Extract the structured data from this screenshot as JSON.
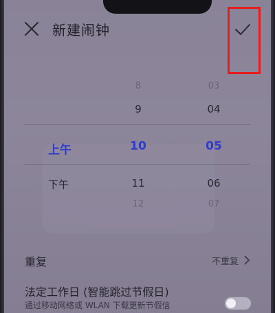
{
  "header": {
    "title": "新建闹钟",
    "close_icon": "close-icon",
    "confirm_icon": "check-icon"
  },
  "picker": {
    "ampm": [
      "上午",
      "下午"
    ],
    "selected_ampm": "上午",
    "hours": [
      "8",
      "9",
      "10",
      "11",
      "12"
    ],
    "selected_hour": "10",
    "minutes": [
      "03",
      "04",
      "05",
      "06",
      "07"
    ],
    "selected_minute": "05"
  },
  "settings": {
    "repeat_label": "重复",
    "repeat_value": "不重复",
    "holiday_title": "法定工作日 (智能跳过节假日)",
    "holiday_subtitle": "通过移动网络或 WLAN 下载更新节假信",
    "holiday_toggle_on": false
  },
  "colors": {
    "highlight": "#e51d1d",
    "selected": "#2f3ccc"
  }
}
